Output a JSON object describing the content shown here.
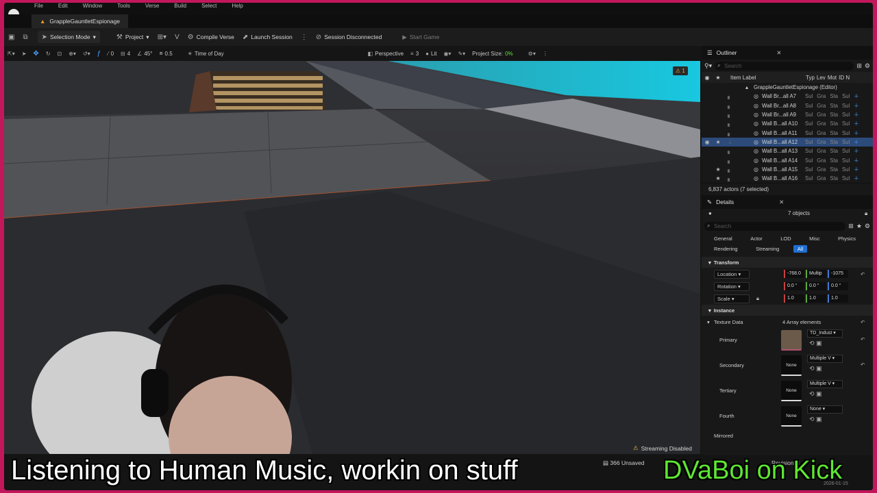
{
  "menu": [
    "File",
    "Edit",
    "Window",
    "Tools",
    "Verse",
    "Build",
    "Select",
    "Help"
  ],
  "document_tab": "GrappleGauntletEspionage",
  "toolbar": {
    "selection_mode": "Selection Mode",
    "project": "Project",
    "compile_verse": "Compile Verse",
    "launch_session": "Launch Session",
    "session_status": "Session Disconnected",
    "start_game": "Start Game"
  },
  "viewport_bar": {
    "snap_rotation": "0",
    "grid_size": "4",
    "angle": "45°",
    "scale": "0.5",
    "time_of_day": "Time of Day",
    "perspective": "Perspective",
    "camera_speed": "3",
    "lit": "Lit",
    "project_size_label": "Project Size:",
    "project_size_value": "0%"
  },
  "viewport": {
    "warning_count": "1",
    "streaming_status": "Streaming Disabled"
  },
  "outliner": {
    "title": "Outliner",
    "search_placeholder": "Search",
    "col_label": "Item Label",
    "col_type": "Typ",
    "col_level": "Lev",
    "col_mobility": "Mot",
    "col_id": "ID N",
    "root": "GrappleGauntletEspionage (Editor)",
    "items": [
      {
        "label": "Wall Br...all A7",
        "selected": false,
        "star": false
      },
      {
        "label": "Wall Br...all A8",
        "selected": false,
        "star": false
      },
      {
        "label": "Wall Br...all A9",
        "selected": false,
        "star": false
      },
      {
        "label": "Wall B...all A10",
        "selected": false,
        "star": false
      },
      {
        "label": "Wall B...all A11",
        "selected": false,
        "star": false
      },
      {
        "label": "Wall B...all A12",
        "selected": true,
        "star": true
      },
      {
        "label": "Wall B...all A13",
        "selected": false,
        "star": false
      },
      {
        "label": "Wall B...all A14",
        "selected": false,
        "star": false
      },
      {
        "label": "Wall B...all A15",
        "selected": false,
        "star": true
      },
      {
        "label": "Wall B...all A16",
        "selected": false,
        "star": true
      }
    ],
    "row_cols": [
      "Sul",
      "Gra",
      "Sta",
      "Sul"
    ],
    "actor_count": "6,837 actors (7 selected)"
  },
  "details": {
    "title": "Details",
    "objects": "7 objects",
    "search_placeholder": "Search",
    "filters": [
      "General",
      "Actor",
      "LOD",
      "Misc",
      "Physics",
      "Rendering",
      "Streaming",
      "All"
    ],
    "active_filter": "All",
    "transform_header": "Transform",
    "location_label": "Location",
    "location_values": [
      "-768.0",
      "Multip",
      "-1075"
    ],
    "rotation_label": "Rotation",
    "rotation_values": [
      "0.0 °",
      "0.0 °",
      "0.0 °"
    ],
    "scale_label": "Scale",
    "scale_values": [
      "1.0",
      "1.0",
      "1.0"
    ],
    "instance_header": "Instance",
    "texture_data_label": "Texture Data",
    "texture_data_value": "4 Array elements",
    "textures": [
      {
        "name": "Primary",
        "value": "TD_Indust",
        "swatch": ""
      },
      {
        "name": "Secondary",
        "value": "Multiple V",
        "swatch": "None"
      },
      {
        "name": "Tertiary",
        "value": "Multiple V",
        "swatch": "None"
      },
      {
        "name": "Fourth",
        "value": "None",
        "swatch": "None"
      }
    ],
    "mirrored_label": "Mirrored"
  },
  "statusbar": {
    "unsaved": "366 Unsaved",
    "revision": "Revision C",
    "date": "2026-01-15"
  },
  "overlay": {
    "caption": "Listening to Human Music, workin on stuff",
    "channel": "DVaBoi on Kick"
  }
}
